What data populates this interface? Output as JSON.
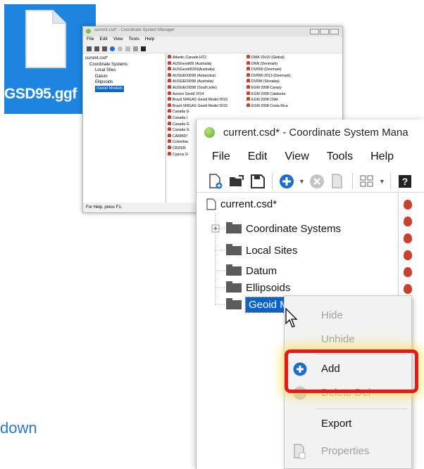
{
  "file_tile": {
    "filename": "GSD95.ggf",
    "icon": "file-icon"
  },
  "small_window": {
    "title": "current.csd* - Coordinate System Manager",
    "menu": [
      "File",
      "Edit",
      "View",
      "Tools",
      "Help"
    ],
    "tree": {
      "root": "current.csd*",
      "items": [
        "Coordinate Systems",
        "Local Sites",
        "Datum",
        "Ellipsoids",
        "Geoid Models"
      ]
    },
    "list_col1": [
      "Atlantic Canada HT2",
      "AUSGeoid09 (Australia)",
      "AUSGeoid2020(Australia)",
      "AUSGEOID98 (Antarctica)",
      "AUSGEOID98 (Australia)",
      "AUSGEOID98 (South pole)",
      "Azores Geoid 2014",
      "Brazil SIRGAS Geoid Model 2010",
      "Brazil SIRGAS Geoid Model 2015",
      "Canada G",
      "Canada I",
      "Canada G",
      "Canada G",
      "CARIB97",
      "Colombia",
      "CR2005",
      "Cyprus G"
    ],
    "list_col2": [
      "DMA 10x10 (Global)",
      "DNN (Denmark)",
      "DVR90 (Denmark)",
      "DVR90 2013 (Denmark)",
      "DVRM (Slovakia)",
      "EGM 2008 Canary",
      "EGM 2008 Catalonia",
      "EGM 2008 Chile",
      "EGM 2008 Costa Rica"
    ],
    "status": "For Help, press F1."
  },
  "large_window": {
    "title": "current.csd* - Coordinate System Mana",
    "menu": [
      "File",
      "Edit",
      "View",
      "Tools",
      "Help"
    ],
    "tree": {
      "root": "current.csd*",
      "items": [
        "Coordinate Systems",
        "Local Sites",
        "Datum",
        "Ellipsoids",
        "Geoid M"
      ]
    }
  },
  "context_menu": {
    "items": [
      {
        "label": "Hide",
        "enabled": false
      },
      {
        "label": "Unhide",
        "enabled": false
      },
      {
        "label": "Add",
        "enabled": true,
        "icon": "plus-circle-icon"
      },
      {
        "label": "Delete   Del",
        "enabled": false,
        "icon": "delete-circle-icon"
      },
      {
        "label": "Export",
        "enabled": true
      },
      {
        "label": "Properties",
        "enabled": false,
        "icon": "properties-icon"
      }
    ]
  },
  "highlight_color": "#e61919",
  "bottom_text": "down"
}
